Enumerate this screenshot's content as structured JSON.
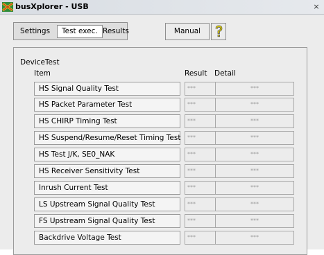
{
  "window": {
    "title": "busXplorer - USB",
    "close_glyph": "×",
    "icon": "busxplorer-logo-icon"
  },
  "tabs": [
    {
      "label": "Settings",
      "active": false
    },
    {
      "label": "Test exec.",
      "active": true
    },
    {
      "label": "Results",
      "active": false
    }
  ],
  "toolbar": {
    "manual_label": "Manual",
    "help_icon": "help-question-icon",
    "help_color": "#d8c800"
  },
  "device_test": {
    "group_label": "DeviceTest",
    "col_item": "Item",
    "col_result": "Result",
    "col_detail": "Detail",
    "tests": [
      {
        "name": "HS Signal Quality Test",
        "result": "***",
        "detail": "***"
      },
      {
        "name": "HS Packet Parameter Test",
        "result": "***",
        "detail": "***"
      },
      {
        "name": "HS CHIRP Timing Test",
        "result": "***",
        "detail": "***"
      },
      {
        "name": "HS Suspend/Resume/Reset Timing Test",
        "result": "***",
        "detail": "***"
      },
      {
        "name": "HS Test J/K, SE0_NAK",
        "result": "***",
        "detail": "***"
      },
      {
        "name": "HS Receiver Sensitivity Test",
        "result": "***",
        "detail": "***"
      },
      {
        "name": "Inrush Current Test",
        "result": "***",
        "detail": "***"
      },
      {
        "name": "LS Upstream Signal Quality Test",
        "result": "***",
        "detail": "***"
      },
      {
        "name": "FS Upstream Signal Quality Test",
        "result": "***",
        "detail": "***"
      },
      {
        "name": "Backdrive Voltage Test",
        "result": "***",
        "detail": "***"
      }
    ]
  }
}
